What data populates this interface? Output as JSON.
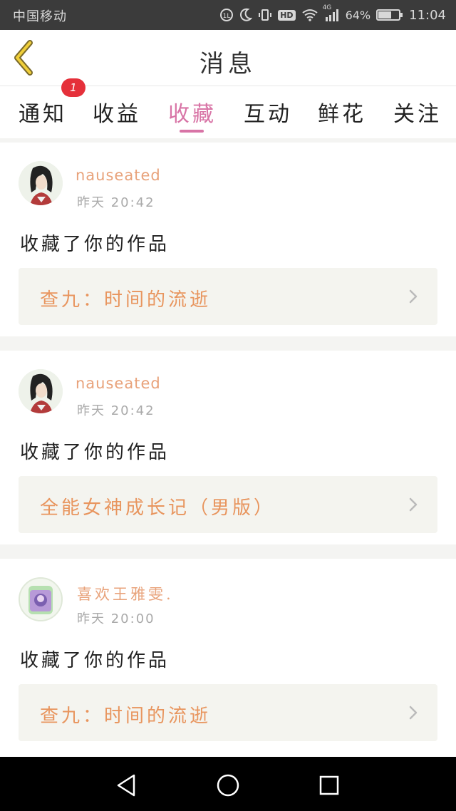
{
  "status_bar": {
    "carrier": "中国移动",
    "battery_text": "64%",
    "battery_level": 0.64,
    "time": "11:04",
    "hd_label": "HD",
    "network_label": "4G"
  },
  "header": {
    "title": "消息"
  },
  "tabs": [
    {
      "label": "通知",
      "badge": "1"
    },
    {
      "label": "收益"
    },
    {
      "label": "收藏",
      "active": true
    },
    {
      "label": "互动"
    },
    {
      "label": "鲜花"
    },
    {
      "label": "关注"
    }
  ],
  "colors": {
    "accent": "#d874a6",
    "username": "#e8a27a",
    "work_title": "#e8955e",
    "badge": "#e5303a"
  },
  "messages": [
    {
      "username": "nauseated",
      "time": "昨天  20:42",
      "action": "收藏了你的作品",
      "work_title": "查九：时间的流逝"
    },
    {
      "username": "nauseated",
      "time": "昨天  20:42",
      "action": "收藏了你的作品",
      "work_title": "全能女神成长记（男版）"
    },
    {
      "username": "喜欢王雅雯.",
      "time": "昨天  20:00",
      "action": "收藏了你的作品",
      "work_title": "查九：时间的流逝"
    }
  ]
}
